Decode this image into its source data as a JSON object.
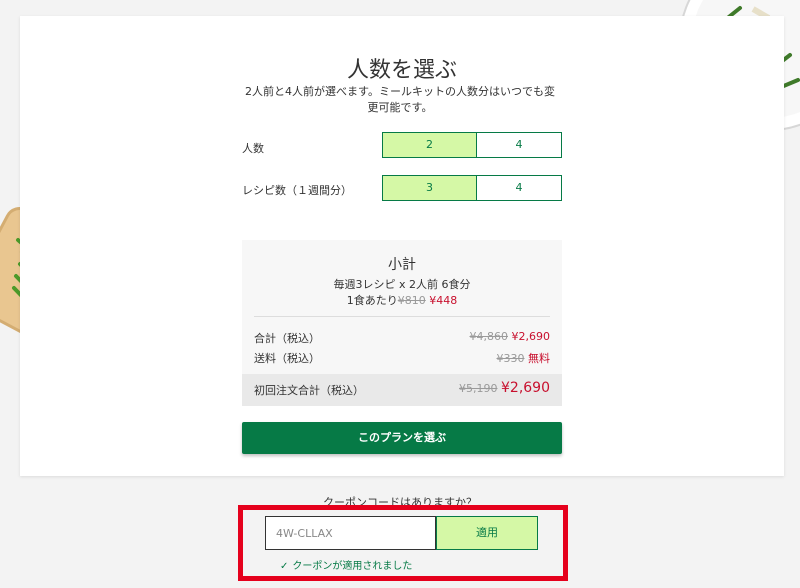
{
  "header": {
    "title": "人数を選ぶ",
    "description": "2人前と4人前が選べます。ミールキットの人数分はいつでも変更可能です。"
  },
  "people": {
    "label": "人数",
    "options": [
      "2",
      "4"
    ],
    "selected": "2"
  },
  "recipes": {
    "label": "レシピ数（１週間分）",
    "options": [
      "3",
      "4"
    ],
    "selected": "3"
  },
  "summary": {
    "title": "小計",
    "line1": "毎週3レシピ x 2人前 6食分",
    "per_meal_label": "1食あたり",
    "per_meal_old": "¥810",
    "per_meal_new": "¥448",
    "subtotal_label": "合計（税込）",
    "subtotal_old": "¥4,860",
    "subtotal_new": "¥2,690",
    "shipping_label": "送料（税込）",
    "shipping_old": "¥330",
    "shipping_new": "無料",
    "first_total_label": "初回注文合計（税込）",
    "first_total_old": "¥5,190",
    "first_total_new": "¥2,690"
  },
  "cta": {
    "plan_button": "このプランを選ぶ"
  },
  "coupon": {
    "question": "クーポンコードはありますか？",
    "value": "4W-CLLAX",
    "apply_label": "適用",
    "applied_message": "クーポンが適用されました",
    "check_icon": "✓"
  },
  "colors": {
    "accent_green": "#067a46",
    "selected_bg": "#d5f8a6",
    "price_red": "#c8102e",
    "highlight_frame": "#e5001c"
  },
  "images": {
    "plate_icon": "salad-plate",
    "board_icon": "green-beans-and-tomatoes"
  }
}
